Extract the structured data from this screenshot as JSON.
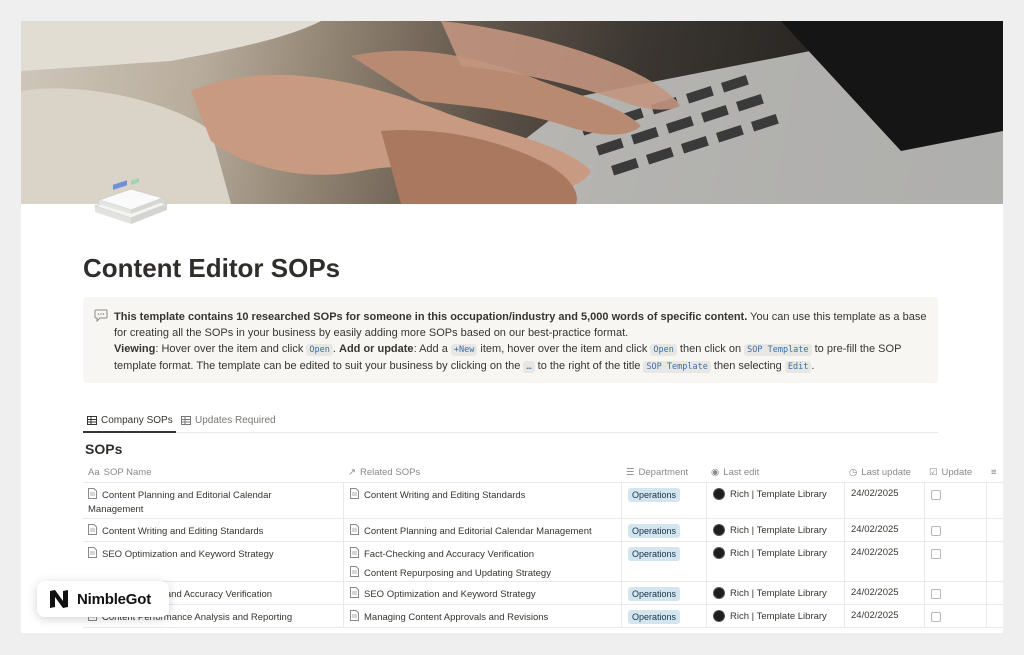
{
  "page": {
    "title": "Content Editor SOPs"
  },
  "callout": {
    "icon": "speech-bubble-icon",
    "line1_bold": "This template contains 10 researched SOPs for someone in this occupation/industry and 5,000 words of specific content.",
    "line1_rest": " You can use this template as a base for creating all the SOPs in your business by easily adding more SOPs based on our best-practice format.",
    "viewing_label": "Viewing",
    "viewing_text": ": Hover over the item and click ",
    "open_code": "Open",
    "sep": ". ",
    "add_label": "Add or update",
    "add_text": ": Add a ",
    "new_code": "+New",
    "add_text2": " item, hover over the item and click ",
    "open_code2": "Open",
    "add_text3": " then click on ",
    "sop_template_code": "SOP Template",
    "add_text4": " to pre-fill the SOP template format. The template can be edited to suit your business by clicking on the ",
    "dots_code": "…",
    "add_text5": " to the right of the title ",
    "sop_template_code2": "SOP Template",
    "add_text6": " then selecting ",
    "edit_code": "Edit",
    "end": "."
  },
  "tabs": [
    {
      "label": "Company SOPs",
      "active": true
    },
    {
      "label": "Updates Required",
      "active": false
    }
  ],
  "database": {
    "title": "SOPs",
    "columns": [
      {
        "prefix": "Aa",
        "label": "SOP Name"
      },
      {
        "prefix": "↗",
        "label": "Related SOPs"
      },
      {
        "prefix": "☰",
        "label": "Department"
      },
      {
        "prefix": "◉",
        "label": "Last edit"
      },
      {
        "prefix": "◷",
        "label": "Last update"
      },
      {
        "prefix": "☑",
        "label": "Update"
      },
      {
        "prefix": "≡",
        "label": ""
      }
    ],
    "rows": [
      {
        "name": [
          "Content Planning and Editorial Calendar",
          "Management"
        ],
        "related": [
          "Content Writing and Editing Standards"
        ],
        "department": "Operations",
        "last_edit": "Rich | Template Library",
        "last_update": "24/02/2025"
      },
      {
        "name": [
          "Content Writing and Editing Standards"
        ],
        "related": [
          "Content Planning and Editorial Calendar Management"
        ],
        "department": "Operations",
        "last_edit": "Rich | Template Library",
        "last_update": "24/02/2025"
      },
      {
        "name": [
          "SEO Optimization and Keyword Strategy"
        ],
        "related": [
          "Fact-Checking and Accuracy Verification",
          "Content Repurposing and Updating Strategy"
        ],
        "department": "Operations",
        "last_edit": "Rich | Template Library",
        "last_update": "24/02/2025"
      },
      {
        "name": [
          "Fact-Checking and Accuracy Verification"
        ],
        "related": [
          "SEO Optimization and Keyword Strategy"
        ],
        "department": "Operations",
        "last_edit": "Rich | Template Library",
        "last_update": "24/02/2025"
      },
      {
        "name": [
          "Content Performance Analysis and Reporting"
        ],
        "related": [
          "Managing Content Approvals and Revisions"
        ],
        "department": "Operations",
        "last_edit": "Rich | Template Library",
        "last_update": "24/02/2025"
      }
    ]
  },
  "badge": {
    "brand": "NimbleGot"
  },
  "colors": {
    "tag_bg": "#d3e5ef",
    "code_text": "#3b6fa8",
    "callout_bg": "#f7f6f3"
  }
}
